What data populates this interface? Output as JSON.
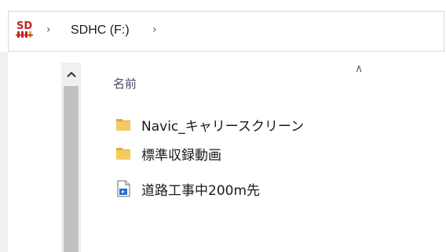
{
  "address_bar": {
    "drive_icon": "sd-card-drive-icon",
    "drive_icon_text": "SD",
    "crumbs": [
      {
        "label": "SDHC (F:)"
      }
    ]
  },
  "file_list": {
    "column_header": "名前",
    "sort_indicator": "ascending",
    "items": [
      {
        "name": "Navic_キャリースクリーン",
        "icon": "folder-icon"
      },
      {
        "name": "標準収録動画",
        "icon": "folder-icon"
      },
      {
        "name": "道路工事中200m先",
        "icon": "video-file-icon"
      }
    ]
  },
  "colors": {
    "folder": "#f4cb62",
    "folder_dark": "#e0a93a",
    "scroll_thumb": "#c1c1c1",
    "sd_icon": "#c0261d"
  }
}
